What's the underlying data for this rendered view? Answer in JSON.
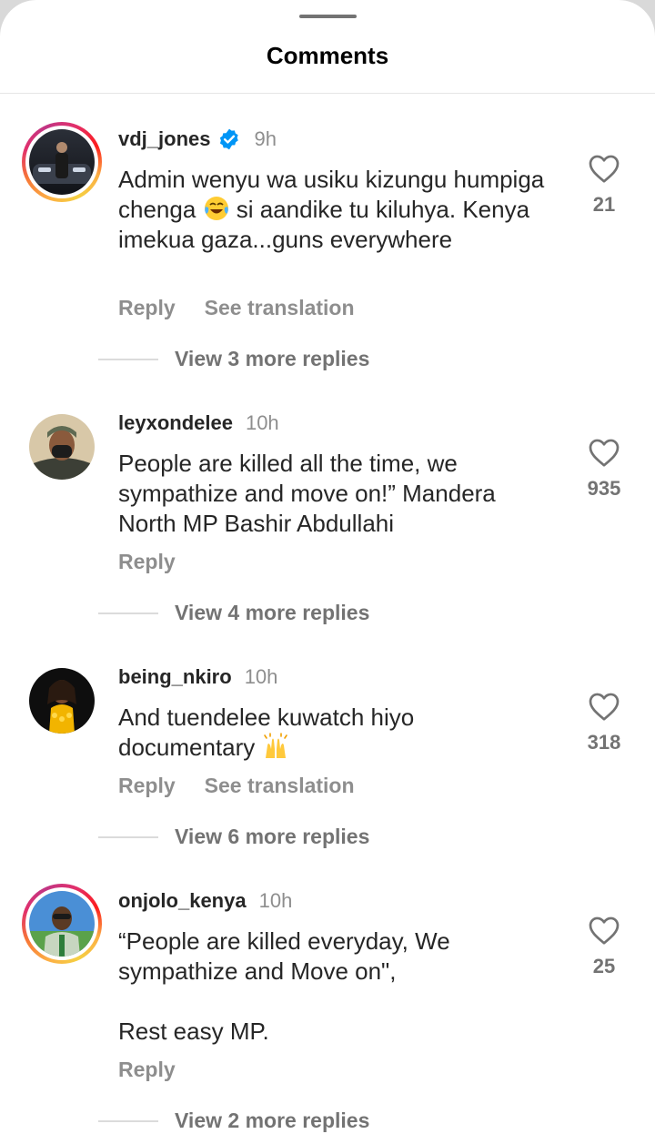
{
  "header": {
    "title": "Comments"
  },
  "comments": [
    {
      "username": "vdj_jones",
      "verified": true,
      "time": "9h",
      "text_before": "Admin wenyu wa usiku kizungu humpiga chenga ",
      "emoji": "laughing-tears-emoji",
      "text_after": " si aandike tu kiluhya. Kenya imekua gaza...guns everywhere",
      "reply_label": "Reply",
      "translate_label": "See translation",
      "likes": "21",
      "replies_label": "View 3 more replies"
    },
    {
      "username": "leyxondelee",
      "verified": false,
      "time": "10h",
      "text": "People are killed all the time, we sympathize and move on!” Mandera North MP Bashir Abdullahi",
      "reply_label": "Reply",
      "likes": "935",
      "replies_label": "View 4 more replies"
    },
    {
      "username": "being_nkiro",
      "verified": false,
      "time": "10h",
      "text_before": "And tuendelee kuwatch hiyo documentary ",
      "emoji": "raising-hands-emoji",
      "reply_label": "Reply",
      "translate_label": "See translation",
      "likes": "318",
      "replies_label": "View 6 more replies"
    },
    {
      "username": "onjolo_kenya",
      "verified": false,
      "time": "10h",
      "text": "“People are killed everyday, We sympathize and Move on\",\n\nRest easy MP.",
      "reply_label": "Reply",
      "likes": "25",
      "replies_label": "View 2 more replies"
    }
  ],
  "icons": {
    "heart": "heart-outline-icon",
    "verified": "verified-badge-icon"
  },
  "colors": {
    "verified_blue": "#0095f6",
    "secondary_text": "#8e8e8e",
    "primary_text": "#262626"
  }
}
